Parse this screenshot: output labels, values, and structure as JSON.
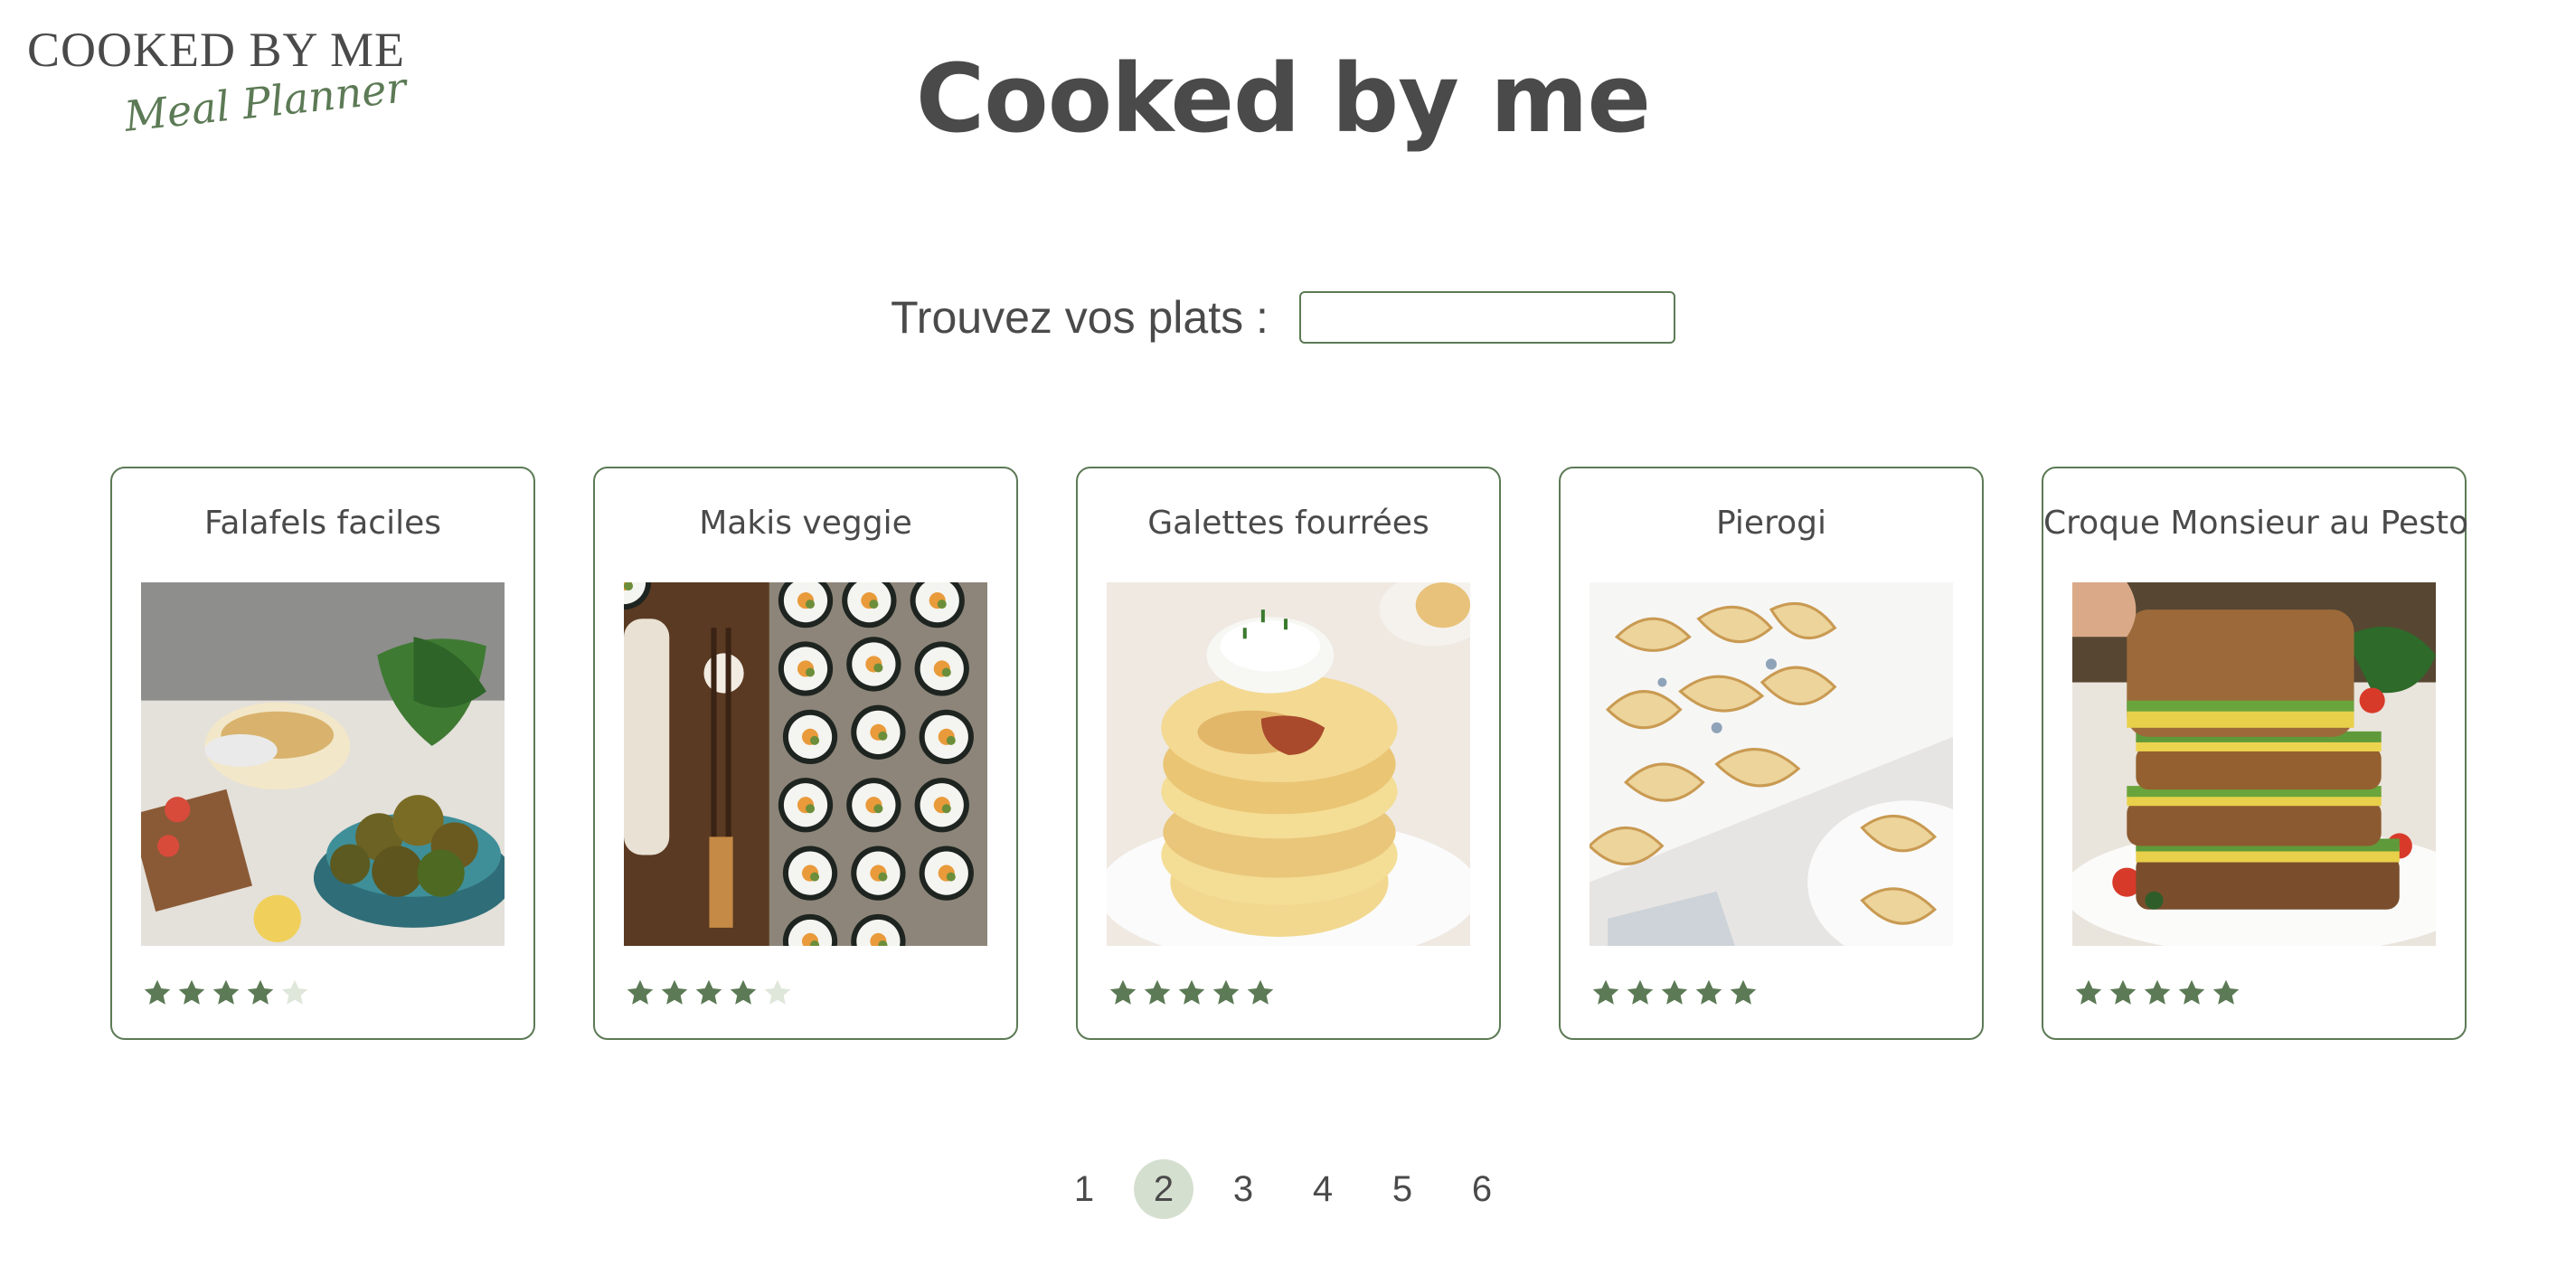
{
  "logo": {
    "title": "COOKED BY ME",
    "subtitle": "Meal Planner"
  },
  "header": {
    "title": "Cooked by me"
  },
  "search": {
    "label": "Trouvez vos plats :",
    "value": "",
    "placeholder": ""
  },
  "colors": {
    "accent": "#5c7a55",
    "star_filled": "#5c7a55",
    "star_empty": "#dfe7db",
    "active_page": "#d5dfd0"
  },
  "recipes": [
    {
      "title": "Falafels faciles",
      "image": "falafel-photo",
      "rating": 4,
      "max_rating": 5
    },
    {
      "title": "Makis veggie",
      "image": "maki-photo",
      "rating": 4,
      "max_rating": 5
    },
    {
      "title": "Galettes fourrées",
      "image": "galettes-photo",
      "rating": 5,
      "max_rating": 5
    },
    {
      "title": "Pierogi",
      "image": "pierogi-photo",
      "rating": 5,
      "max_rating": 5
    },
    {
      "title": "Croque Monsieur au Pesto",
      "image": "croque-photo",
      "rating": 5,
      "max_rating": 5
    }
  ],
  "pagination": {
    "pages": [
      "1",
      "2",
      "3",
      "4",
      "5",
      "6"
    ],
    "current": "2"
  }
}
